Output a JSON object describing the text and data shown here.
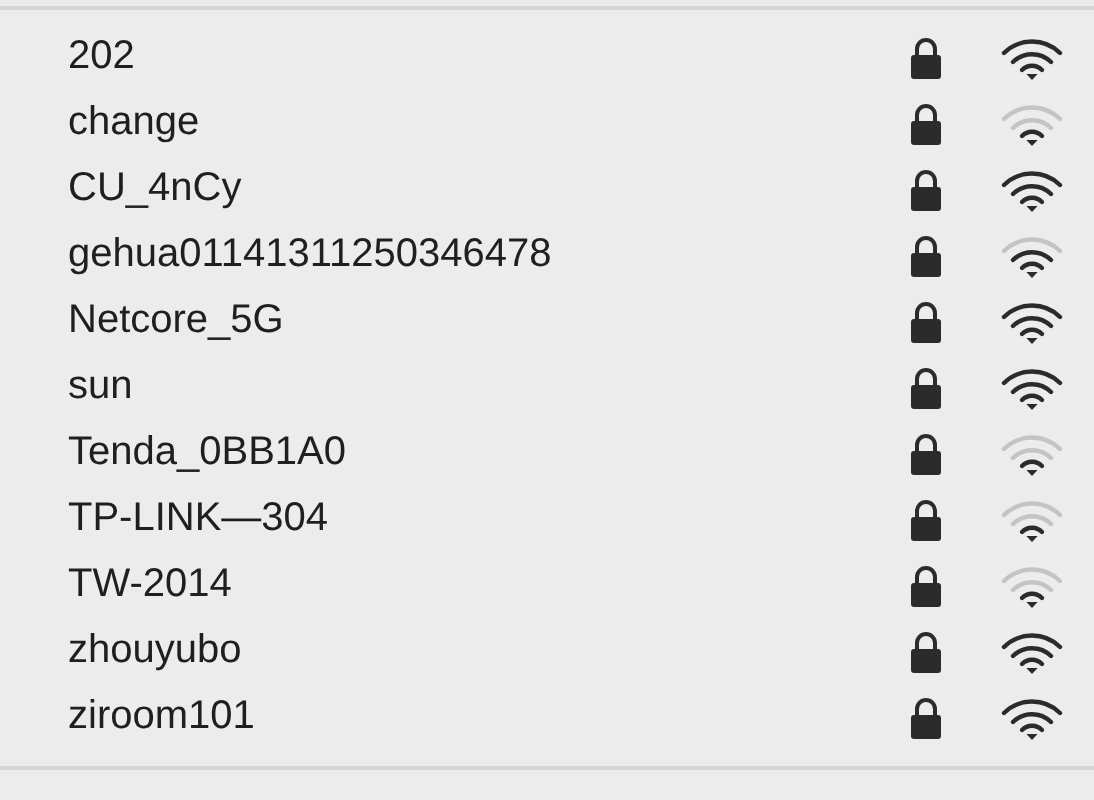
{
  "networks": [
    {
      "name": "202",
      "locked": true,
      "kind": "strong"
    },
    {
      "name": "change",
      "locked": true,
      "kind": "weak"
    },
    {
      "name": "CU_4nCy",
      "locked": true,
      "kind": "strong"
    },
    {
      "name": "gehua01141311250346478",
      "locked": true,
      "kind": "medium"
    },
    {
      "name": "Netcore_5G",
      "locked": true,
      "kind": "strong"
    },
    {
      "name": "sun",
      "locked": true,
      "kind": "strong"
    },
    {
      "name": "Tenda_0BB1A0",
      "locked": true,
      "kind": "weak"
    },
    {
      "name": "TP-LINK—304",
      "locked": true,
      "kind": "weak"
    },
    {
      "name": "TW-2014",
      "locked": true,
      "kind": "weak"
    },
    {
      "name": "zhouyubo",
      "locked": true,
      "kind": "strong"
    },
    {
      "name": "ziroom101",
      "locked": true,
      "kind": "strong"
    }
  ]
}
